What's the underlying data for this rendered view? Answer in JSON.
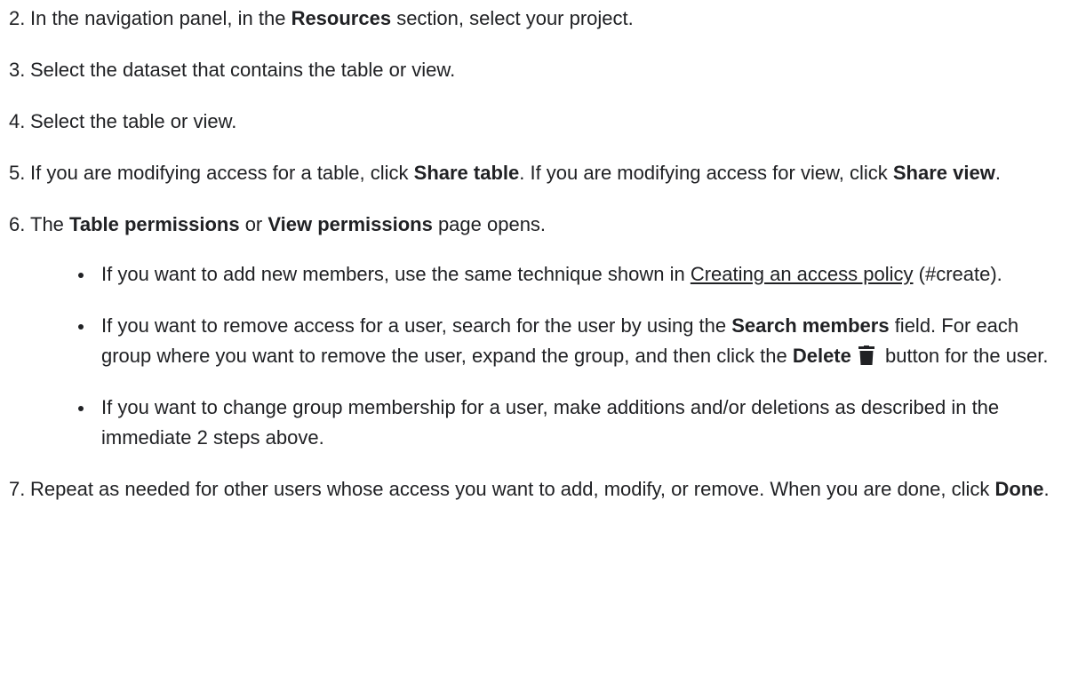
{
  "steps": [
    {
      "num": "2.",
      "pre": "In the navigation panel, in the ",
      "bold": "Resources",
      "post": " section, select your project."
    },
    {
      "num": "3.",
      "text": "Select the dataset that contains the table or view."
    },
    {
      "num": "4.",
      "text": "Select the table or view."
    },
    {
      "num": "5.",
      "pre": "If you are modifying access for a table, click ",
      "bold1": "Share table",
      "mid": ". If you are modifying access for view, click ",
      "bold2": "Share view",
      "post": "."
    },
    {
      "num": "6.",
      "pre": "The ",
      "bold1": "Table permissions",
      "mid": " or ",
      "bold2": "View permissions",
      "post": " page opens.",
      "bullets": {
        "b1": {
          "pre": "If you want to add new members, use the same technique shown in ",
          "link": "Creating an access policy",
          "post": " (#create)."
        },
        "b2": {
          "pre": "If you want to remove access for a user, search for the user by using the ",
          "bold1": "Search members",
          "mid": " field. For each group where you want to remove the user, expand the group, and then click the ",
          "bold2": "Delete",
          "icon": "trash-icon",
          "post": " button for the user."
        },
        "b3": {
          "text": "If you want to change group membership for a user, make additions and/or deletions as described in the immediate 2 steps above."
        }
      }
    },
    {
      "num": "7.",
      "pre": "Repeat as needed for other users whose access you want to add, modify, or remove. When you are done, click ",
      "bold": "Done",
      "post": "."
    }
  ]
}
